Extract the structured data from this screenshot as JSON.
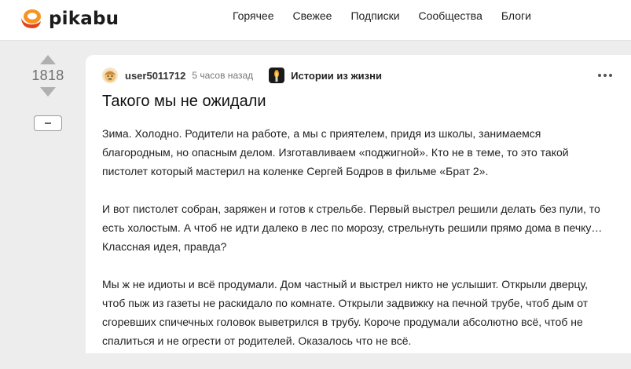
{
  "header": {
    "logo_text": "pikabu",
    "nav": [
      {
        "label": "Горячее"
      },
      {
        "label": "Свежее"
      },
      {
        "label": "Подписки"
      },
      {
        "label": "Сообщества"
      },
      {
        "label": "Блоги"
      }
    ]
  },
  "vote": {
    "rating": "1818",
    "up_icon": "triangle-up-icon",
    "down_icon": "triangle-down-icon",
    "collapse_icon": "minus-icon"
  },
  "story": {
    "author": "user5011712",
    "time": "5 часов назад",
    "community": "Истории из жизни",
    "title": "Такого мы не ожидали",
    "paragraphs": [
      "Зима. Холодно. Родители на работе, а мы с приятелем, придя из школы, занимаемся благородным, но опасным делом. Изготавливаем «поджигной». Кто не в теме, то это такой пистолет который мастерил на коленке Сергей Бодров в фильме «Брат 2».",
      "И вот пистолет собран, заряжен и готов к стрельбе. Первый выстрел решили делать без пули, то есть холостым. А чтоб не идти далеко в лес по морозу, стрельнуть решили прямо дома в печку… Классная идея, правда?",
      "Мы ж не идиоты и всё продумали. Дом частный и выстрел никто не услышит. Открыли дверцу, чтоб пыж из газеты не раскидало по комнате. Открыли задвижку на печной трубе, чтоб дым от сгоревших спичечных головок выветрился в трубу. Короче продумали абсолютно всё, чтоб не спалиться и не огрести от родителей. Оказалось что не всё."
    ]
  },
  "colors": {
    "logo_orange": "#f7931e",
    "logo_red": "#e2451b",
    "vote_arrow": "#b0b0b0",
    "page_bg": "#ededed"
  }
}
